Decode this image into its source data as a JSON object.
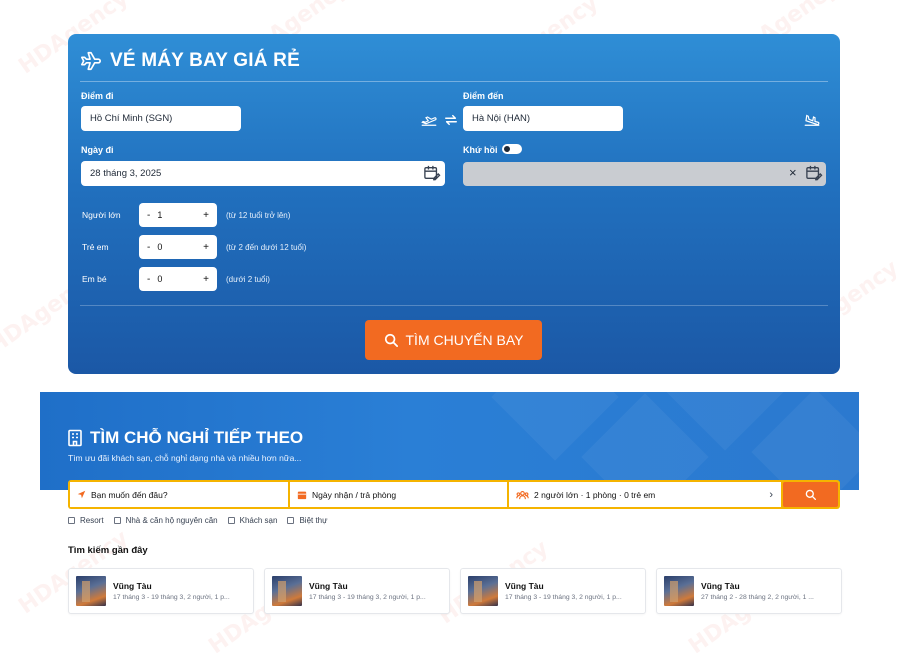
{
  "flight": {
    "title": "VÉ MÁY BAY GIÁ RẺ",
    "from_label": "Điểm đi",
    "from_value": "Hồ Chí Minh (SGN)",
    "to_label": "Điểm đến",
    "to_value": "Hà Nội (HAN)",
    "depart_label": "Ngày đi",
    "depart_value": "28 tháng 3, 2025",
    "return_label": "Khứ hồi",
    "return_toggle_on": false,
    "return_clear": "×",
    "passengers": [
      {
        "label": "Người lớn",
        "minus": "-",
        "value": "1",
        "plus": "+",
        "note": "(từ 12 tuổi trở lên)"
      },
      {
        "label": "Trẻ em",
        "minus": "-",
        "value": "0",
        "plus": "+",
        "note": "(từ 2 đến dưới 12 tuổi)"
      },
      {
        "label": "Em bé",
        "minus": "-",
        "value": "0",
        "plus": "+",
        "note": "(dưới 2 tuổi)"
      }
    ],
    "search_label": "TÌM CHUYẾN BAY"
  },
  "hotel": {
    "title": "TÌM CHỖ NGHỈ TIẾP THEO",
    "subtitle": "Tìm ưu đãi khách sạn, chỗ nghỉ dạng nhà và nhiều hơn nữa...",
    "destination_placeholder": "Bạn muốn đến đâu?",
    "dates_placeholder": "Ngày nhận / trả phòng",
    "guests_value": "2 người lớn · 1 phòng · 0 trẻ em",
    "guests_chevron": "›",
    "filters": [
      "Resort",
      "Nhà & căn hộ nguyên căn",
      "Khách sạn",
      "Biệt thự"
    ],
    "recent_title": "Tìm kiếm gần đây",
    "recent": [
      {
        "name": "Vũng Tàu",
        "detail": "17 tháng 3 - 19 tháng 3, 2 người, 1 p..."
      },
      {
        "name": "Vũng Tàu",
        "detail": "17 tháng 3 - 19 tháng 3, 2 người, 1 p..."
      },
      {
        "name": "Vũng Tàu",
        "detail": "17 tháng 3 - 19 tháng 3, 2 người, 1 p..."
      },
      {
        "name": "Vũng Tàu",
        "detail": "27 tháng 2 - 28 tháng 2, 2 người, 1 ..."
      }
    ]
  },
  "colors": {
    "accent_orange": "#f26a21",
    "search_bar_yellow": "#f5b400",
    "flight_blue": "#2170be"
  },
  "icons": [
    "plane-icon",
    "takeoff-icon",
    "swap-icon",
    "landing-icon",
    "calendar-icon",
    "search-icon",
    "hotel-icon",
    "location-arrow-icon",
    "people-icon",
    "close-icon"
  ]
}
